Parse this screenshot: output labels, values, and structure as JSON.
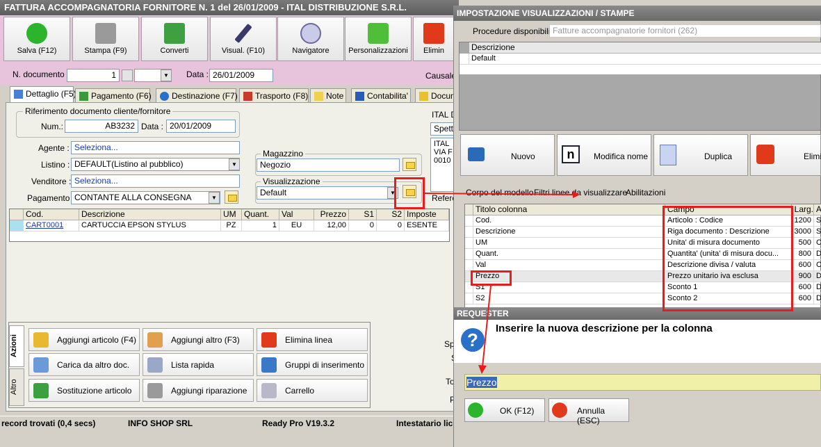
{
  "main": {
    "title": "FATTURA ACCOMPAGNATORIA FORNITORE N. 1 del 26/01/2009 - ITAL DISTRIBUZIONE S.R.L.",
    "toolbar": [
      "Salva (F12)",
      "Stampa (F9)",
      "Converti",
      "Visual. (F10)",
      "Navigatore",
      "Personalizzazioni",
      "Elimin"
    ],
    "ndoc_label": "N. documento :",
    "ndoc_value": "1",
    "data_label": "Data :",
    "data_value": "26/01/2009",
    "causale_label": "Causale",
    "tabs": [
      "Dettaglio (F5)",
      "Pagamento (F6)",
      "Destinazione (F7)",
      "Trasporto (F8)",
      "Note",
      "Contabilita'",
      "Docum"
    ],
    "rif_title": "Riferimento documento cliente/fornitore",
    "num_label": "Num.:",
    "num_value": "AB3232",
    "rif_data_label": "Data :",
    "rif_data_value": "20/01/2009",
    "agente_label": "Agente :",
    "agente_value": "Seleziona...",
    "listino_label": "Listino :",
    "listino_value": "DEFAULT(Listino al pubblico)",
    "venditore_label": "Venditore :",
    "venditore_value": "Seleziona...",
    "pagamento_label": "Pagamento :",
    "pagamento_value": "CONTANTE ALLA CONSEGNA",
    "magazzino_title": "Magazzino",
    "magazzino_value": "Negozio",
    "vis_title": "Visualizzazione",
    "vis_value": "Default",
    "ital_head": "ITAL D",
    "spett": "Spett",
    "addr": [
      "ITAL",
      "VIA F",
      "0010"
    ],
    "refer": "Refere",
    "right_labels": [
      "Spe",
      "S",
      "To",
      "P"
    ],
    "grid_headers": [
      "Cod.",
      "Descrizione",
      "UM",
      "Quant.",
      "Val",
      "Prezzo",
      "S1",
      "S2",
      "Imposte"
    ],
    "grid_row": [
      "CART0001",
      "CARTUCCIA EPSON STYLUS",
      "PZ",
      "1",
      "EU",
      "12,00",
      "0",
      "0",
      "ESENTE"
    ],
    "side_tabs": [
      "Azioni",
      "Altro"
    ],
    "actions": [
      "Aggiungi articolo (F4)",
      "Aggiungi altro (F3)",
      "Elimina linea",
      "Carica da altro doc.",
      "Lista rapida",
      "Gruppi di inserimento",
      "Sostituzione articolo",
      "Aggiungi riparazione",
      "Carrello"
    ],
    "status": [
      "record trovati (0,4 secs)",
      "INFO SHOP SRL",
      "Ready Pro V19.3.2",
      "Intestatario lic"
    ]
  },
  "settings": {
    "title": "IMPOSTAZIONE VISUALIZZAZIONI / STAMPE",
    "proc_label": "Procedure disponibili :",
    "proc_value": "Fatture accompagnatorie fornitori (262)",
    "desc_header": "Descrizione",
    "desc_row": "Default",
    "buttons": [
      "Nuovo",
      "Modifica nome",
      "Duplica",
      "Elimin"
    ],
    "tabs": [
      "Corpo del modello",
      "Filtri linee da visualizzare",
      "Abilitazioni"
    ],
    "headers": [
      "Titolo colonna",
      "Campo",
      "Larg.",
      "Al"
    ],
    "rows": [
      [
        "Cod.",
        "Articolo : Codice",
        "1200",
        "Sin"
      ],
      [
        "Descrizione",
        "Riga documento : Descrizione",
        "3000",
        "Sin"
      ],
      [
        "UM",
        "Unita' di misura documento",
        "500",
        "Ce"
      ],
      [
        "Quant.",
        "Quantita' (unita' di misura docu...",
        "800",
        "De"
      ],
      [
        "Val",
        "Descrizione divisa / valuta",
        "600",
        "Ce"
      ],
      [
        "Prezzo",
        "Prezzo unitario iva esclusa",
        "900",
        "De"
      ],
      [
        "S1",
        "Sconto 1",
        "600",
        "De"
      ],
      [
        "S2",
        "Sconto 2",
        "600",
        "De"
      ]
    ]
  },
  "requester": {
    "title": "REQUESTER",
    "message": "Inserire la nuova descrizione per la colonna",
    "input": "Prezzo",
    "ok": "OK (F12)",
    "cancel": "Annulla (ESC)"
  }
}
